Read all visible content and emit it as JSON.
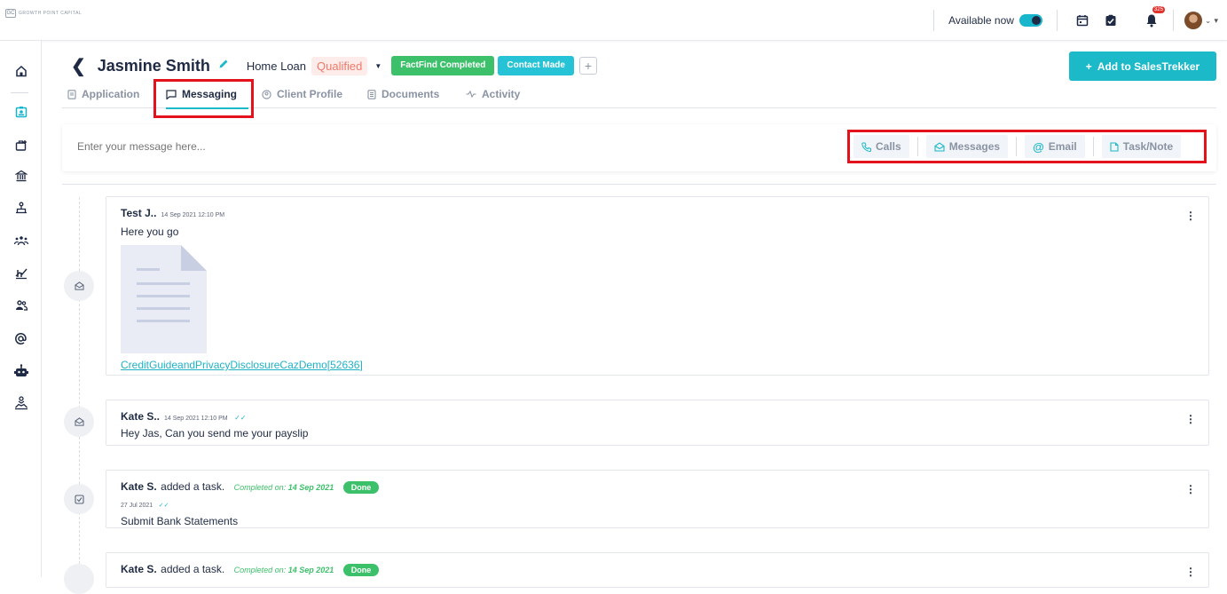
{
  "topbar": {
    "logo_mark": "GC",
    "logo_text": "GROWTH POINT CAPITAL",
    "availability_label": "Available now",
    "notification_count": "325"
  },
  "sidebar": {
    "items": [
      "home-icon",
      "clients-icon",
      "briefcase-add-icon",
      "bank-icon",
      "hierarchy-icon",
      "team-icon",
      "analytics-icon",
      "users-icon",
      "at-icon",
      "robot-icon",
      "handshake-icon"
    ]
  },
  "header": {
    "client_name": "Jasmine Smith",
    "loan_type": "Home Loan",
    "status": "Qualified",
    "pills": [
      "FactFind Completed",
      "Contact Made"
    ],
    "add_button": "Add to SalesTrekker"
  },
  "tabs": [
    {
      "label": "Application",
      "icon": "document-icon"
    },
    {
      "label": "Messaging",
      "icon": "chat-icon",
      "active": true
    },
    {
      "label": "Client Profile",
      "icon": "profile-icon"
    },
    {
      "label": "Documents",
      "icon": "documents-icon"
    },
    {
      "label": "Activity",
      "icon": "activity-icon"
    }
  ],
  "composer": {
    "placeholder": "Enter your message here...",
    "actions": [
      "Calls",
      "Messages",
      "Email",
      "Task/Note"
    ]
  },
  "feed": [
    {
      "author": "Test J..",
      "timestamp": "14 Sep 2021 12:10 PM",
      "text": "Here you go",
      "attachment": "CreditGuideandPrivacyDisclosureCazDemo[52636]"
    },
    {
      "author": "Kate S..",
      "timestamp": "14 Sep 2021 12:10 PM",
      "text": "Hey Jas, Can you send me your payslip"
    },
    {
      "author": "Kate S.",
      "action": "added a task.",
      "completed_label": "Completed on:",
      "completed_date": "14 Sep 2021",
      "badge": "Done",
      "date": "27 Jul 2021",
      "text": "Submit Bank Statements"
    },
    {
      "author": "Kate S.",
      "action": "added a task.",
      "completed_label": "Completed on:",
      "completed_date": "14 Sep 2021",
      "badge": "Done"
    }
  ],
  "colors": {
    "accent": "#1cb9c9",
    "success": "#3cc06a",
    "qualified": "#f07a6a",
    "highlight": "#e3121d"
  }
}
